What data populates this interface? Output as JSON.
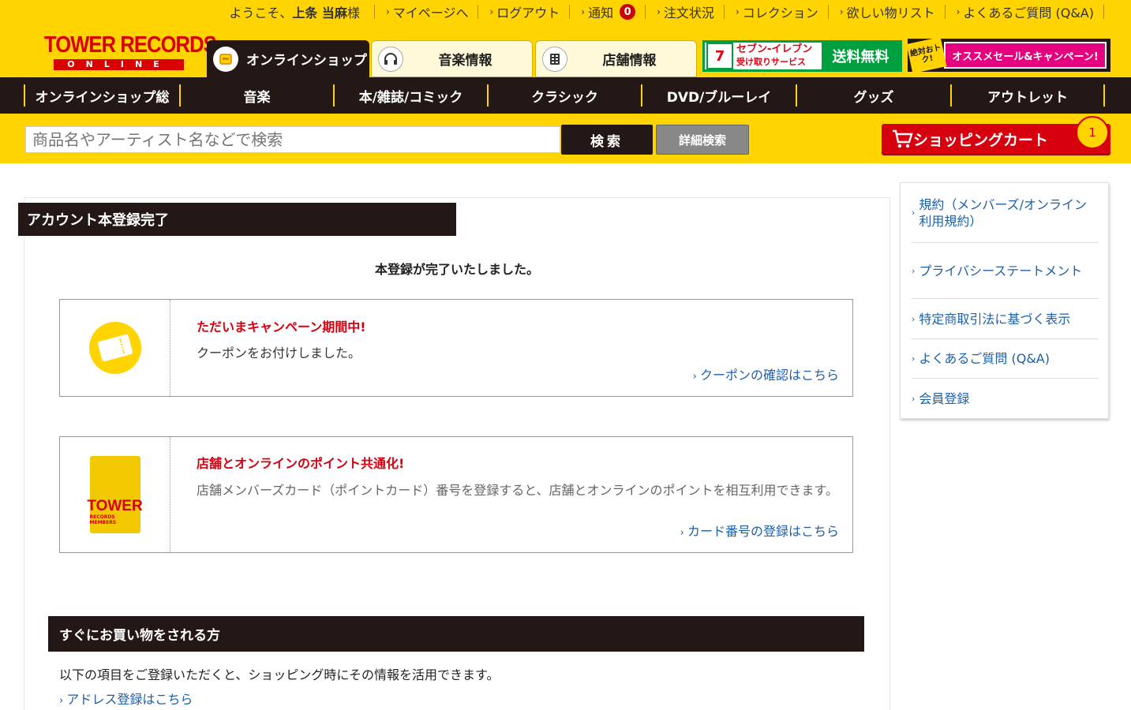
{
  "topbar": {
    "welcome_prefix": "ようこそ、",
    "user_name": "上条 当麻",
    "welcome_suffix": "様",
    "links": [
      {
        "label": "マイページへ"
      },
      {
        "label": "ログアウト"
      },
      {
        "label": "通知",
        "count": "0"
      },
      {
        "label": "注文状況"
      },
      {
        "label": "コレクション"
      },
      {
        "label": "欲しい物リスト"
      },
      {
        "label": "よくあるご質問 (Q&A)"
      }
    ]
  },
  "logo": {
    "main": "TOWER RECORDS",
    "sub": "ONLINE"
  },
  "tabs": [
    {
      "label": "オンラインショップ",
      "icon": "shop-icon"
    },
    {
      "label": "音楽情報",
      "icon": "headphones-icon"
    },
    {
      "label": "店舗情報",
      "icon": "store-icon"
    }
  ],
  "banners": {
    "seven_logo": "7",
    "seven_text_1": "セブン-イレブン",
    "seven_text_2": "受け取りサービス",
    "seven_free": "送料無料",
    "sale_tag": "絶対おトク!",
    "sale_text": "オススメセール&キャンペーン!"
  },
  "categories": [
    "オンラインショップ総",
    "音楽",
    "本/雑誌/コミック",
    "クラシック",
    "DVD/ブルーレイ",
    "グッズ",
    "アウトレット"
  ],
  "search": {
    "placeholder": "商品名やアーティスト名などで検索",
    "button": "検索",
    "advanced": "詳細検索"
  },
  "cart": {
    "label": "ショッピングカート",
    "count": "1"
  },
  "main": {
    "section_title": "アカウント本登録完了",
    "done_message": "本登録が完了いたしました。",
    "coupon_card": {
      "title": "ただいまキャンペーン期間中!",
      "text": "クーポンをお付けしました。",
      "link": "クーポンの確認はこちら"
    },
    "points_card": {
      "title": "店舗とオンラインのポイント共通化!",
      "text": "店舗メンバーズカード（ポイントカード）番号を登録すると、店舗とオンラインのポイントを相互利用できます。",
      "link": "カード番号の登録はこちら",
      "card_logo": "TOWER",
      "card_logo_sub": "RECORDS MEMBERS"
    },
    "section2_title": "すぐにお買い物をされる方",
    "intro": "以下の項目をご登録いただくと、ショッピング時にその情報を活用できます。",
    "address_link": "アドレス登録はこちら"
  },
  "sidebar": {
    "items": [
      "規約（メンバーズ/オンライン利用規約）",
      "プライバシーステートメント",
      "特定商取引法に基づく表示",
      "よくあるご質問 (Q&A)",
      "会員登録"
    ]
  },
  "colors": {
    "brand_yellow": "#ffd400",
    "brand_dark": "#231815",
    "brand_red": "#d7000f",
    "link_blue": "#1d5fa8"
  }
}
